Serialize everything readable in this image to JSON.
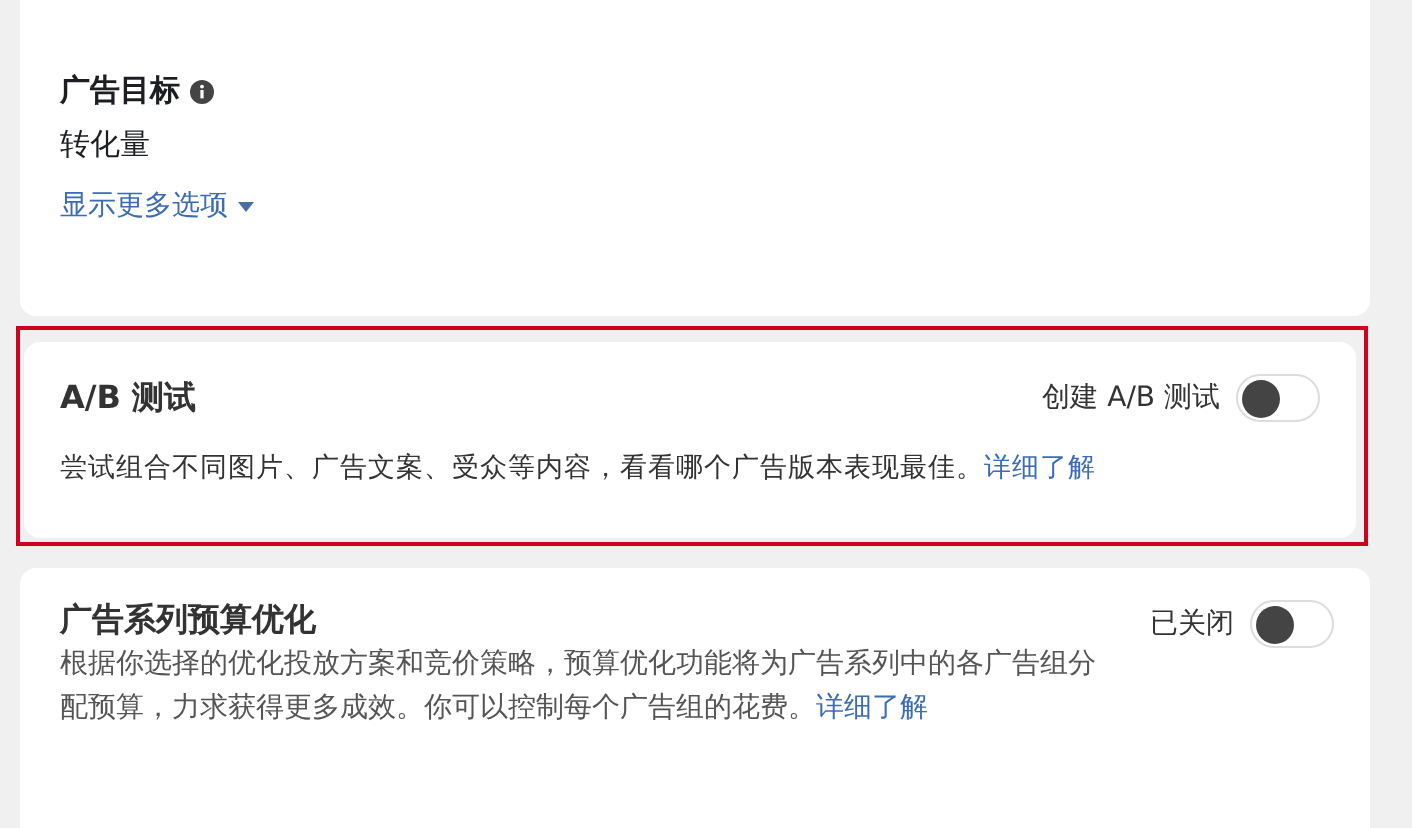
{
  "ad_objective": {
    "label": "广告目标",
    "value": "转化量"
  },
  "more_options": {
    "label": "显示更多选项"
  },
  "ab_test": {
    "title": "A/B 测试",
    "highlighted": true,
    "toggle_label": "创建 A/B 测试",
    "on": false,
    "description": "尝试组合不同图片、广告文案、受众等内容，看看哪个广告版本表现最佳。",
    "link": "详细了解"
  },
  "budget_optimization": {
    "title": "广告系列预算优化",
    "toggle_label": "已关闭",
    "on": false,
    "description": "根据你选择的优化投放方案和竞价策略，预算优化功能将为广告系列中的各广告组分配预算，力求获得更多成效。你可以控制每个广告组的花费。",
    "link": "详细了解"
  }
}
